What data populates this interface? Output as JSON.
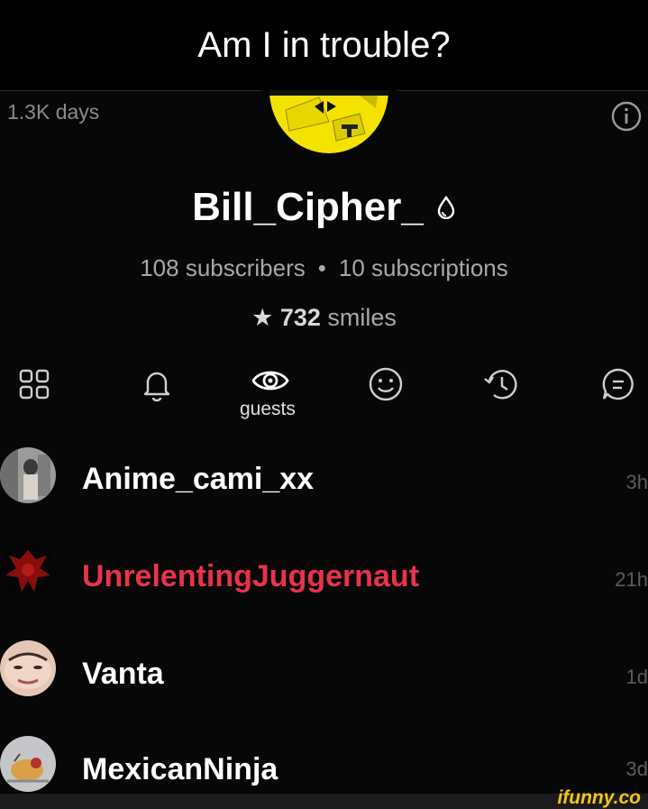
{
  "caption": "Am I in trouble?",
  "profile": {
    "days": "1.3K days",
    "username": "Bill_Cipher_",
    "subscribers": "108 subscribers",
    "separator": "•",
    "subscriptions": "10 subscriptions",
    "smiles_count": "732",
    "smiles_label": "smiles"
  },
  "tabs": {
    "guests_label": "guests"
  },
  "guests": [
    {
      "name": "Anime_cami_xx",
      "time": "3h",
      "color": "#ffffff"
    },
    {
      "name": "UnrelentingJuggernaut",
      "time": "21h",
      "color": "#e8334a"
    },
    {
      "name": "Vanta",
      "time": "1d",
      "color": "#ffffff"
    },
    {
      "name": "MexicanNinja",
      "time": "3d",
      "color": "#ffffff"
    }
  ],
  "watermark": "ifunny.co"
}
